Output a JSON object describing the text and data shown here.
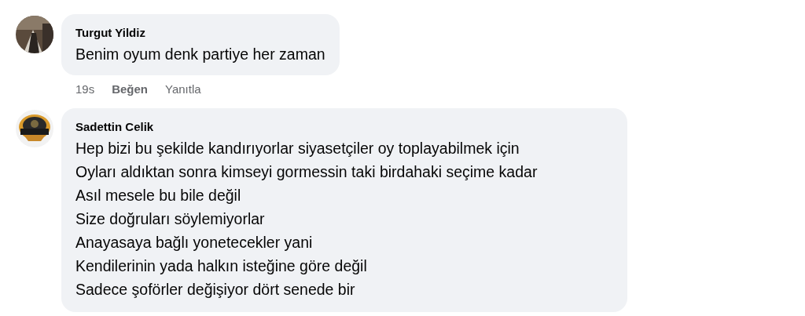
{
  "comments": [
    {
      "author": "Turgut Yildiz",
      "lines": [
        "Benim oyum denk partiye her zaman"
      ],
      "avatar": {
        "kind": "picture"
      },
      "time": "19s",
      "like": "Beğen",
      "reply": "Yanıtla"
    },
    {
      "author": "Sadettin Celik",
      "lines": [
        "Hep bizi bu şekilde kandırıyorlar siyasetçiler oy toplayabilmek için",
        "Oyları aldıktan sonra kimseyi gormessin taki birdahaki seçime kadar",
        "Asıl mesele bu bile değil",
        "Size doğruları söylemiyorlar",
        "Anayasaya bağlı yonetecekler yani",
        "Kendilerinin yada halkın isteğine göre değil",
        "Sadece şoförler değişiyor dört senede bir"
      ],
      "avatar": {
        "kind": "picture"
      }
    }
  ]
}
